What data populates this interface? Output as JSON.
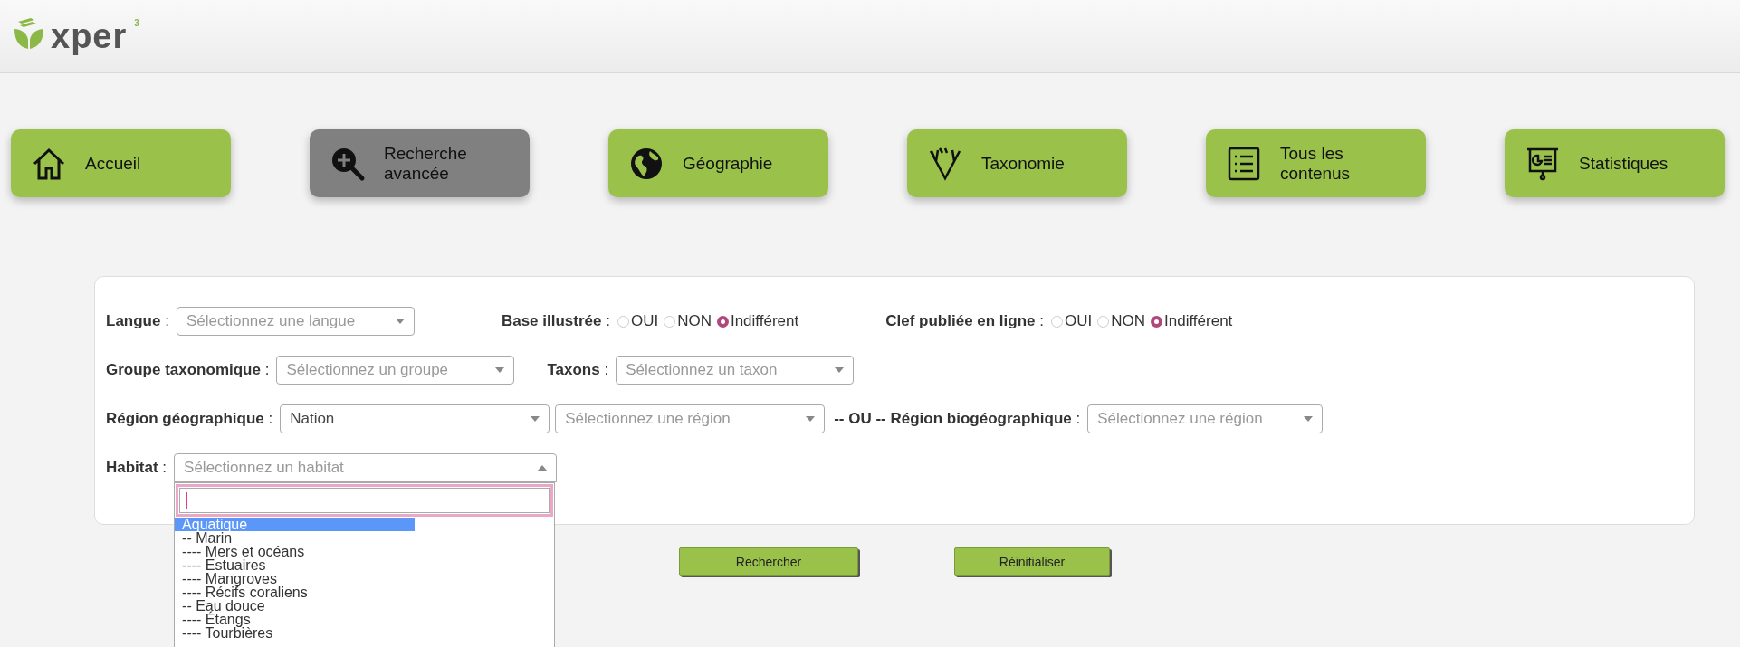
{
  "logo": {
    "name": "xper",
    "version": "3"
  },
  "nav": [
    {
      "label": "Accueil",
      "selected": false
    },
    {
      "label": "Recherche avancée",
      "selected": true
    },
    {
      "label": "Géographie",
      "selected": false
    },
    {
      "label": "Taxonomie",
      "selected": false
    },
    {
      "label": "Tous les contenus",
      "selected": false
    },
    {
      "label": "Statistiques",
      "selected": false
    }
  ],
  "form": {
    "rows": [
      {
        "fields": [
          {
            "kind": "label",
            "text": "**Langue** :"
          },
          {
            "kind": "select",
            "placeholder": "Sélectionnez une langue",
            "expanded": false
          },
          {
            "kind": "label",
            "text": "**Base illustrée** :"
          },
          {
            "kind": "radio",
            "options": [
              {
                "label": "OUI",
                "selected": false
              },
              {
                "label": "NON",
                "selected": false
              },
              {
                "label": "Indifférent",
                "selected": true
              }
            ]
          },
          {
            "kind": "label",
            "text": "**Clef publiée en ligne** :"
          },
          {
            "kind": "radio",
            "options": [
              {
                "label": "OUI",
                "selected": false
              },
              {
                "label": "NON",
                "selected": false
              },
              {
                "label": "Indifférent",
                "selected": true
              }
            ]
          }
        ]
      },
      {
        "fields": [
          {
            "kind": "label",
            "text": "**Groupe taxonomique** :"
          },
          {
            "kind": "select",
            "placeholder": "Sélectionnez un groupe",
            "expanded": false
          },
          {
            "kind": "label",
            "text": "**Taxons** :"
          },
          {
            "kind": "select",
            "placeholder": "Sélectionnez un taxon",
            "expanded": false
          }
        ]
      },
      {
        "fields": [
          {
            "kind": "label",
            "text": "**Région géographique** :"
          },
          {
            "kind": "select",
            "value": "Nation",
            "expanded": false
          },
          {
            "kind": "select",
            "placeholder": "Sélectionnez une région",
            "expanded": false
          },
          {
            "kind": "label",
            "text": "**-- OU -- Région biogéographique** :"
          },
          {
            "kind": "select",
            "placeholder": "Sélectionnez une région",
            "expanded": false
          }
        ]
      },
      {
        "fields": [
          {
            "kind": "label",
            "text": "**Habitat** :"
          },
          {
            "kind": "select",
            "placeholder": "Sélectionnez un habitat",
            "expanded": true,
            "options": [
              {
                "label": "Aquatique",
                "selected": true
              },
              {
                "label": "-- Marin",
                "selected": false
              },
              {
                "label": "---- Mers et océans",
                "selected": false
              },
              {
                "label": "---- Estuaires",
                "selected": false
              },
              {
                "label": "---- Mangroves",
                "selected": false
              },
              {
                "label": "---- Récifs coraliens",
                "selected": false
              },
              {
                "label": "-- Eau douce",
                "selected": false
              },
              {
                "label": "---- Étangs",
                "selected": false
              },
              {
                "label": "---- Tourbières",
                "selected": false
              }
            ]
          }
        ]
      }
    ]
  },
  "buttons": [
    "Rechercher",
    "Réinitialiser"
  ]
}
